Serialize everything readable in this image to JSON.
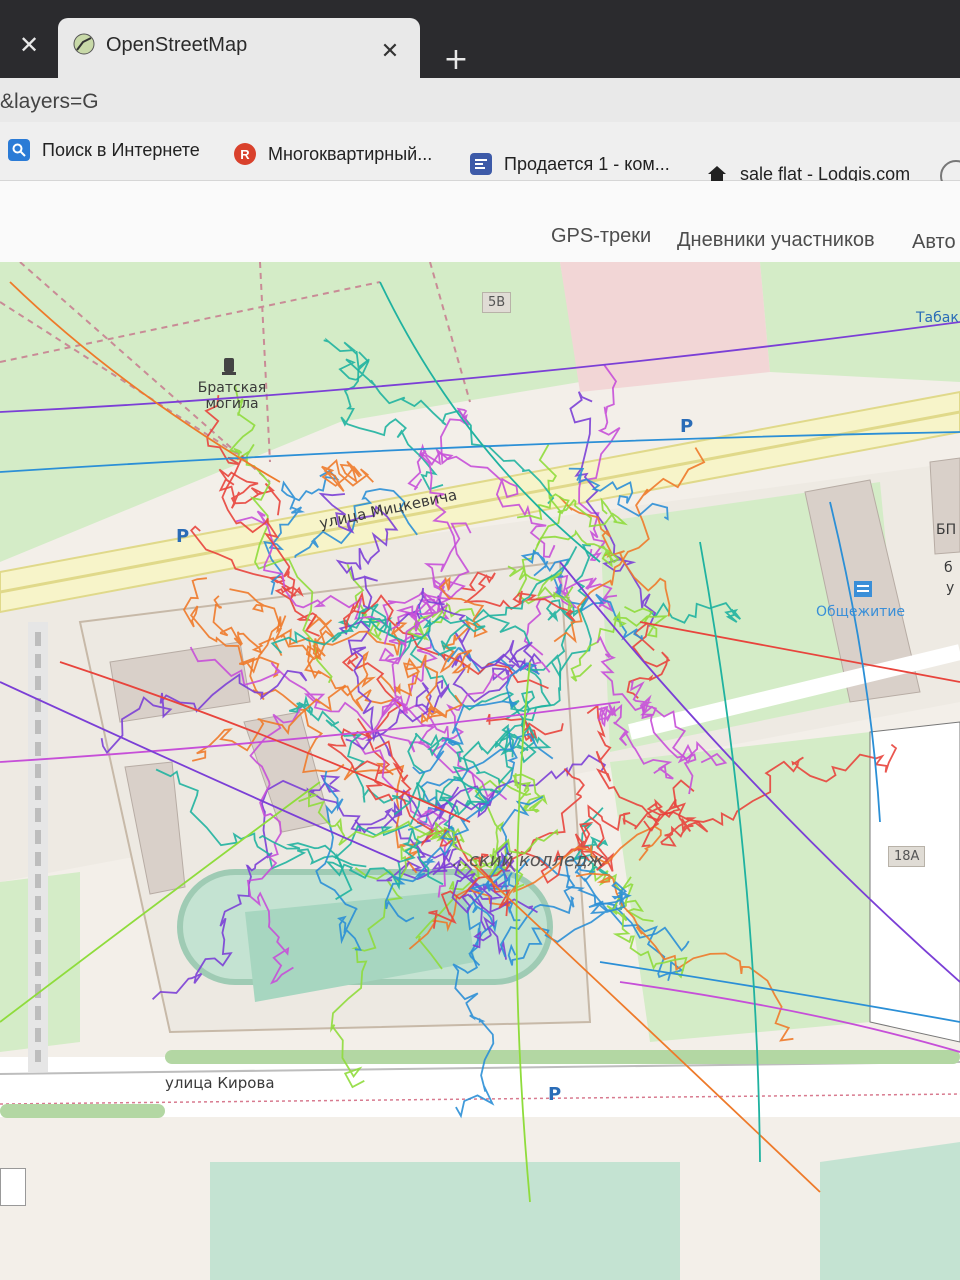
{
  "browser": {
    "tab": {
      "title": "OpenStreetMap"
    },
    "address_bar": {
      "value": "&layers=G"
    },
    "bookmarks": [
      {
        "label": "Поиск в Интернете",
        "icon": "search-icon",
        "color": "#2b7bd6"
      },
      {
        "label": "Многоквартирный...",
        "icon": "r-letter-icon",
        "color": "#d9412c"
      },
      {
        "label": "Продается 1 - ком...",
        "icon": "listing-icon",
        "color": "#3d5aa8"
      },
      {
        "label": "sale flat - Lodgis.com",
        "icon": "house-icon",
        "color": "#333333"
      }
    ]
  },
  "header": {
    "nav": [
      "GPS-треки",
      "Дневники участников",
      "Авто"
    ]
  },
  "map": {
    "labels": {
      "memorial": "Братская могила",
      "street_top": "улица Мицкевича",
      "dormitory": "Общежитие",
      "college": "...ский колледж",
      "street_bottom": "улица Кирова",
      "shop": "Табак",
      "right_edge_1": "БП",
      "right_edge_2": "б",
      "right_edge_3": "у"
    },
    "house_numbers": [
      "5В",
      "18А"
    ],
    "parking_symbol": "P",
    "track_colors": [
      "#7b3fd6",
      "#e8443c",
      "#8fdc3c",
      "#2b8fd6",
      "#1fb2a0",
      "#ee7a2a",
      "#c64fd8"
    ]
  }
}
